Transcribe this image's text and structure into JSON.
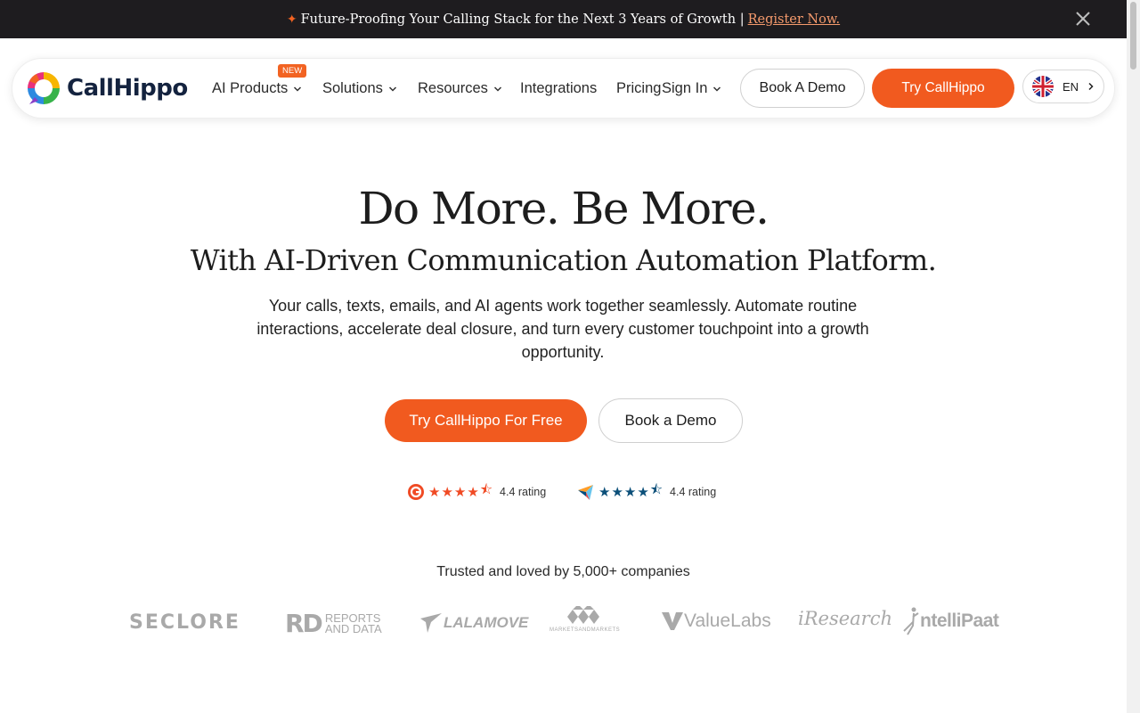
{
  "announcement": {
    "text": "Future-Proofing Your Calling Stack for the Next 3 Years of Growth |",
    "link": "Register Now."
  },
  "brand": {
    "name": "CallHippo"
  },
  "nav": {
    "items": [
      {
        "label": "AI Products",
        "badge": "NEW"
      },
      {
        "label": "Solutions"
      },
      {
        "label": "Resources"
      },
      {
        "label": "Integrations"
      },
      {
        "label": "Pricing"
      },
      {
        "label": "Sign In"
      }
    ],
    "book_demo": "Book A Demo",
    "try": "Try CallHippo",
    "language": "EN"
  },
  "hero": {
    "title": "Do More. Be More.",
    "subtitle": "With AI-Driven Communication Automation Platform.",
    "description": "Your calls, texts, emails, and AI agents work together seamlessly. Automate routine interactions, accelerate deal closure, and turn every customer touchpoint into a growth opportunity.",
    "cta_primary": "Try CallHippo For Free",
    "cta_secondary": "Book a Demo"
  },
  "ratings": [
    {
      "source_icon": "g2-icon",
      "value": "4.4 rating",
      "color": "#f04a24"
    },
    {
      "source_icon": "capterra-icon",
      "value": "4.4 rating",
      "color": "#0b4f79"
    }
  ],
  "trusted": {
    "title": "Trusted and loved by 5,000+ companies",
    "logos": [
      {
        "name": "SECLORE"
      },
      {
        "name": "RD",
        "line1": "REPORTS",
        "line2": "AND DATA"
      },
      {
        "name": "LALAMOVE"
      },
      {
        "name": "MARKETSANDMARKETS"
      },
      {
        "name": "ValueLabs"
      },
      {
        "name": "iResearch"
      },
      {
        "name": "ntelliPaat"
      }
    ]
  },
  "colors": {
    "accent": "#f15a1f",
    "topbar": "#1e1c1f",
    "logo_gray": "#a9a9a9"
  }
}
